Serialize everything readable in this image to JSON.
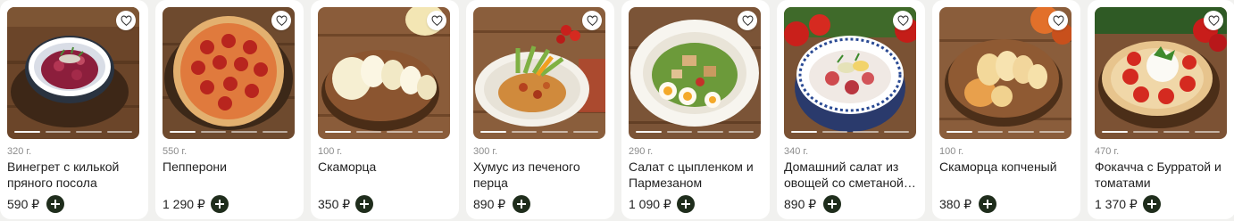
{
  "products": [
    {
      "weight": "320 г.",
      "name": "Винегрет с килькой пряного посола",
      "price": "590 ₽",
      "photo": "vinaigrette-bowl"
    },
    {
      "weight": "550 г.",
      "name": "Пепперони",
      "price": "1 290 ₽",
      "photo": "pepperoni-pizza"
    },
    {
      "weight": "100 г.",
      "name": "Скаморца",
      "price": "350 ₽",
      "photo": "scamorza-cheese"
    },
    {
      "weight": "300 г.",
      "name": "Хумус из печеного перца",
      "price": "890 ₽",
      "photo": "hummus-plate"
    },
    {
      "weight": "290 г.",
      "name": "Салат с цыпленком и Пармезаном",
      "price": "1 090 ₽",
      "photo": "chicken-salad"
    },
    {
      "weight": "340 г.",
      "name": "Домашний салат из овощей со сметаной…",
      "price": "890 ₽",
      "photo": "vegetable-salad"
    },
    {
      "weight": "100 г.",
      "name": "Скаморца копченый",
      "price": "380 ₽",
      "photo": "smoked-scamorza"
    },
    {
      "weight": "470 г.",
      "name": "Фокачча с Бурратой и томатами",
      "price": "1 370 ₽",
      "photo": "focaccia-burrata"
    }
  ],
  "icons": {
    "favorite": "heart-icon",
    "add": "plus-icon"
  },
  "colors": {
    "card": "#ffffff",
    "page": "#f1f1ef",
    "add_button": "#1f2d1c",
    "weight_text": "#8c8c8c",
    "wood": "#7a5235"
  }
}
